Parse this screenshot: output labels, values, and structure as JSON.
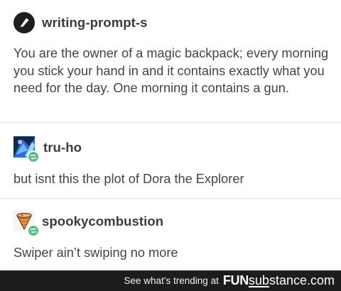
{
  "posts": [
    {
      "username": "writing-prompt-s",
      "avatar_icon": "pen-nib-icon",
      "text": "You are the owner of a magic backpack; every morning you stick your hand in and it contains exactly what you need for the day. One morning it contains a gun."
    },
    {
      "username": "tru-ho",
      "avatar_icon": "blue-abstract-avatar",
      "badge_icon": "reblog-icon",
      "text": "but isnt this the plot of Dora the Explorer"
    },
    {
      "username": "spookycombustion",
      "avatar_icon": "ice-cream-cone-avatar",
      "badge_icon": "reblog-icon",
      "text": "Swiper ain’t swiping no more"
    }
  ],
  "footer": {
    "trending_text": "See what’s trending at",
    "brand_fun": "FUN",
    "brand_sub": "sub",
    "brand_tail": "stance.com"
  },
  "colors": {
    "reblog_badge": "#56bc8a",
    "footer_bg": "#1d1d1d"
  }
}
